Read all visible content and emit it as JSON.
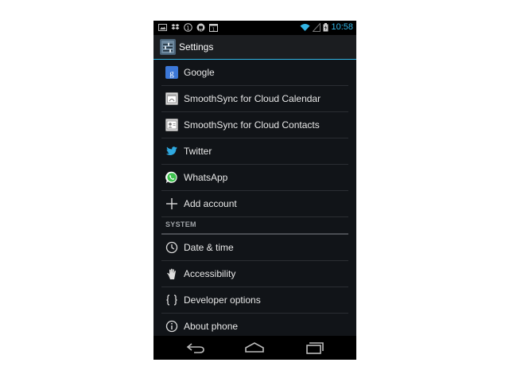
{
  "status_bar": {
    "time": "10:58",
    "left_icons": [
      "gallery-notification-icon",
      "dropbox-icon",
      "one-badge-icon",
      "android-icon",
      "calendar-notification-icon"
    ],
    "right_icons": [
      "wifi-icon",
      "signal-icon",
      "battery-icon"
    ]
  },
  "action_bar": {
    "title": "Settings"
  },
  "accounts": [
    {
      "label": "Google",
      "icon": "google-icon"
    },
    {
      "label": "SmoothSync for Cloud Calendar",
      "icon": "calendar-icon"
    },
    {
      "label": "SmoothSync for Cloud Contacts",
      "icon": "contacts-icon"
    },
    {
      "label": "Twitter",
      "icon": "twitter-icon"
    },
    {
      "label": "WhatsApp",
      "icon": "whatsapp-icon"
    },
    {
      "label": "Add account",
      "icon": "plus-icon"
    }
  ],
  "system_section": {
    "header": "SYSTEM",
    "items": [
      {
        "label": "Date & time",
        "icon": "clock-icon"
      },
      {
        "label": "Accessibility",
        "icon": "hand-icon"
      },
      {
        "label": "Developer options",
        "icon": "braces-icon"
      },
      {
        "label": "About phone",
        "icon": "info-icon"
      }
    ]
  },
  "nav_bar": {
    "buttons": [
      "back-icon",
      "home-icon",
      "recents-icon"
    ]
  },
  "colors": {
    "accent": "#33b5e5",
    "background": "#111418",
    "text": "#e8e8e8"
  }
}
